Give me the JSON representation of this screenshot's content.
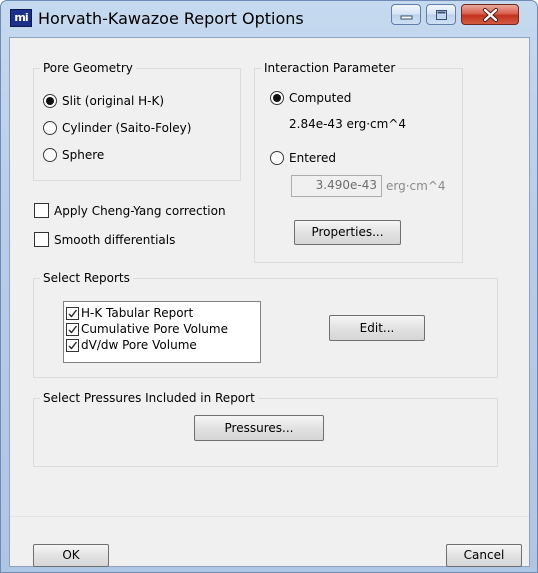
{
  "window": {
    "title": "Horvath-Kawazoe Report Options",
    "app_icon_text": "mi",
    "controls": {
      "minimize_icon": "minimize-icon",
      "maximize_icon": "maximize-icon",
      "close_icon": "close-icon"
    }
  },
  "pore_geometry": {
    "label": "Pore Geometry",
    "options": [
      {
        "label": "Slit (original H-K)",
        "selected": true
      },
      {
        "label": "Cylinder (Saito-Foley)",
        "selected": false
      },
      {
        "label": "Sphere",
        "selected": false
      }
    ]
  },
  "interaction_parameter": {
    "label": "Interaction Parameter",
    "computed_label": "Computed",
    "computed_selected": true,
    "computed_value": "2.84e-43  erg·cm^4",
    "entered_label": "Entered",
    "entered_selected": false,
    "entered_value": "3.490e-43",
    "entered_unit": "erg·cm^4",
    "properties_button": "Properties..."
  },
  "options": {
    "cheng_yang_label": "Apply Cheng-Yang correction",
    "cheng_yang_checked": false,
    "smooth_label": "Smooth differentials",
    "smooth_checked": false
  },
  "select_reports": {
    "label": "Select Reports",
    "items": [
      {
        "label": "H-K Tabular Report",
        "checked": true
      },
      {
        "label": "Cumulative Pore Volume",
        "checked": true
      },
      {
        "label": "dV/dw Pore Volume",
        "checked": true
      }
    ],
    "edit_button": "Edit..."
  },
  "pressures": {
    "label": "Select Pressures Included in Report",
    "button": "Pressures..."
  },
  "footer": {
    "ok_button": "OK",
    "cancel_button": "Cancel"
  }
}
